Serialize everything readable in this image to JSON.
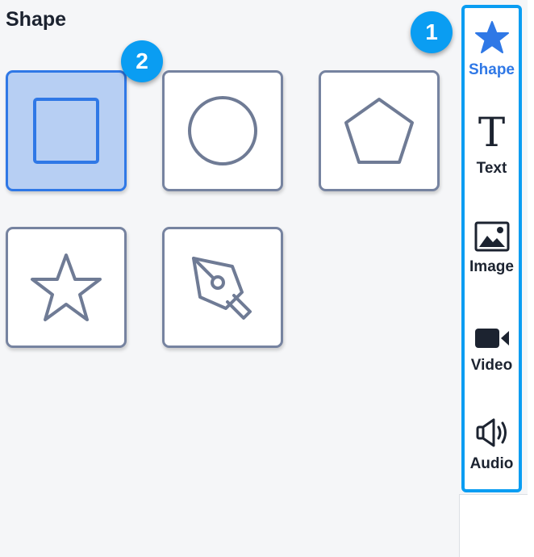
{
  "panel": {
    "title": "Shape",
    "tiles": [
      {
        "icon": "square-icon",
        "selected": true
      },
      {
        "icon": "circle-icon",
        "selected": false
      },
      {
        "icon": "pentagon-icon",
        "selected": false
      },
      {
        "icon": "star-outline-icon",
        "selected": false
      },
      {
        "icon": "pen-tool-icon",
        "selected": false
      }
    ]
  },
  "badges": {
    "first": "1",
    "second": "2"
  },
  "rail": {
    "items": [
      {
        "label": "Shape",
        "icon": "star-icon",
        "active": true
      },
      {
        "label": "Text",
        "icon": "text-icon",
        "glyph": "T",
        "active": false
      },
      {
        "label": "Image",
        "icon": "image-icon",
        "active": false
      },
      {
        "label": "Video",
        "icon": "video-icon",
        "active": false
      },
      {
        "label": "Audio",
        "icon": "audio-icon",
        "active": false
      }
    ]
  },
  "colors": {
    "accent": "#2f78e6",
    "badge": "#0a9df2",
    "tile_border": "#7683a0",
    "selected_fill": "#b7cff3"
  }
}
